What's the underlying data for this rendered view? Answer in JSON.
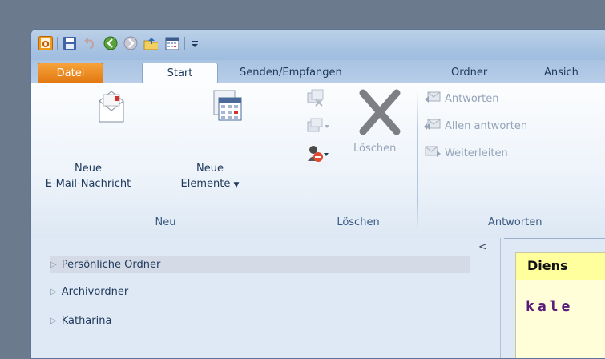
{
  "qat": {
    "icons": [
      "outlook-app-icon",
      "save-icon",
      "undo-icon",
      "back-icon",
      "forward-icon",
      "folder-up-icon",
      "calendar-icon",
      "customize-qat-icon"
    ]
  },
  "tabs": {
    "file": "Datei",
    "start": "Start",
    "send_receive": "Senden/Empfangen",
    "folder": "Ordner",
    "view": "Ansich"
  },
  "ribbon": {
    "new_email_line1": "Neue",
    "new_email_line2": "E-Mail-Nachricht",
    "new_items_line1": "Neue",
    "new_items_line2": "Elemente",
    "new_group": "Neu",
    "delete_label": "Löschen",
    "delete_group": "Löschen",
    "reply": "Antworten",
    "reply_all": "Allen antworten",
    "forward": "Weiterleiten",
    "respond_group": "Antworten"
  },
  "nav": {
    "items": [
      "Persönliche Ordner",
      "Archivordner",
      "Katharina"
    ],
    "collapse_glyph": "<"
  },
  "preview": {
    "header": "Diens",
    "body": "kale"
  }
}
